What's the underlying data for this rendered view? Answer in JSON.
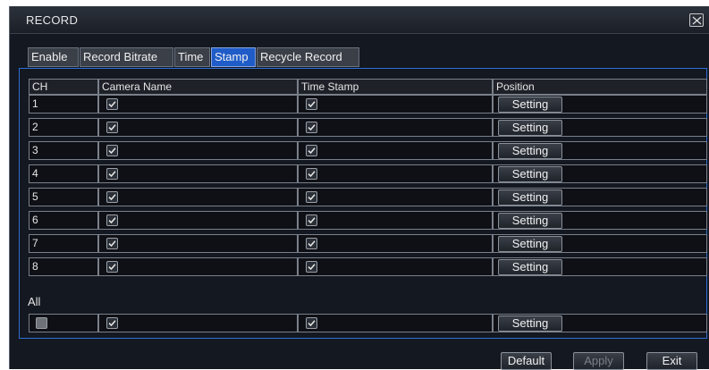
{
  "window": {
    "title": "RECORD"
  },
  "tabs": [
    {
      "label": "Enable",
      "active": false
    },
    {
      "label": "Record Bitrate",
      "active": false
    },
    {
      "label": "Time",
      "active": false
    },
    {
      "label": "Stamp",
      "active": true
    },
    {
      "label": "Recycle Record",
      "active": false
    }
  ],
  "table": {
    "headers": [
      "CH",
      "Camera Name",
      "Time Stamp",
      "Position"
    ],
    "rows": [
      {
        "ch": "1",
        "camera_name": true,
        "time_stamp": true,
        "position": "Setting"
      },
      {
        "ch": "2",
        "camera_name": true,
        "time_stamp": true,
        "position": "Setting"
      },
      {
        "ch": "3",
        "camera_name": true,
        "time_stamp": true,
        "position": "Setting"
      },
      {
        "ch": "4",
        "camera_name": true,
        "time_stamp": true,
        "position": "Setting"
      },
      {
        "ch": "5",
        "camera_name": true,
        "time_stamp": true,
        "position": "Setting"
      },
      {
        "ch": "6",
        "camera_name": true,
        "time_stamp": true,
        "position": "Setting"
      },
      {
        "ch": "7",
        "camera_name": true,
        "time_stamp": true,
        "position": "Setting"
      },
      {
        "ch": "8",
        "camera_name": true,
        "time_stamp": true,
        "position": "Setting"
      }
    ]
  },
  "all_section": {
    "label": "All",
    "all_selected": false,
    "camera_name": true,
    "time_stamp": true,
    "position": "Setting"
  },
  "buttons": {
    "default": "Default",
    "apply": "Apply",
    "exit": "Exit"
  },
  "colors": {
    "active_tab": "#1f5cc8",
    "panel_border": "#2f6fd6",
    "background": "#141820"
  }
}
